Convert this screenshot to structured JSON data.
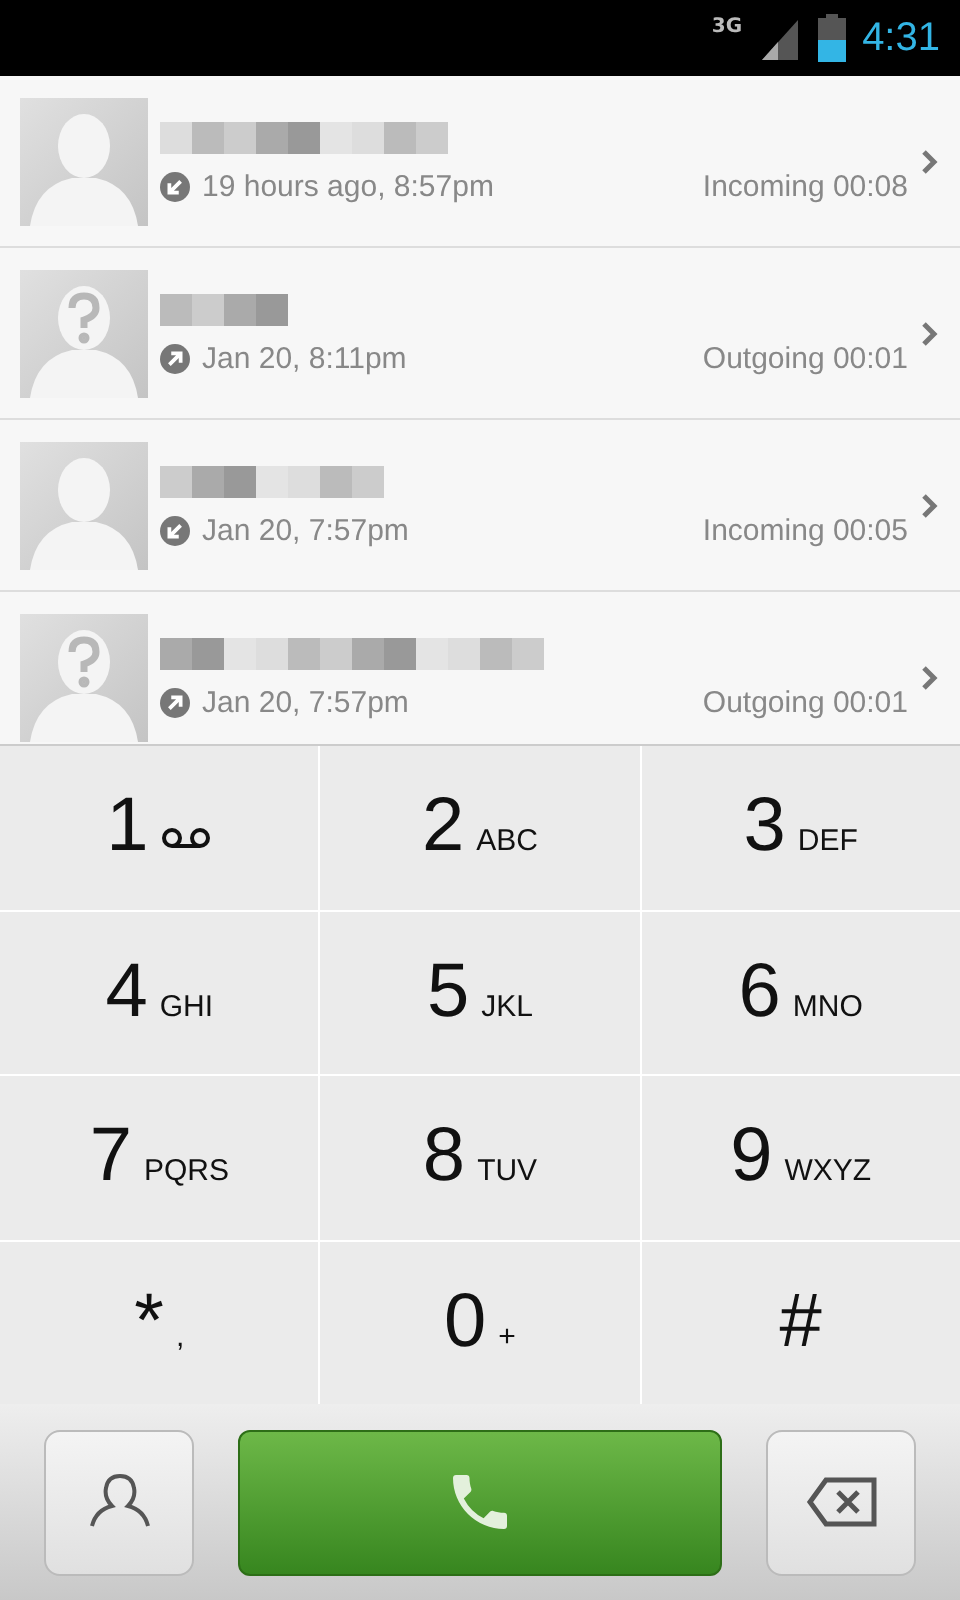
{
  "status_bar": {
    "network": "3G",
    "time": "4:31"
  },
  "calls": [
    {
      "unknown_caller": false,
      "outgoing": false,
      "when": "19 hours ago, 8:57pm",
      "detail": "Incoming 00:08"
    },
    {
      "unknown_caller": true,
      "outgoing": true,
      "when": "Jan 20, 8:11pm",
      "detail": "Outgoing 00:01"
    },
    {
      "unknown_caller": false,
      "outgoing": false,
      "when": "Jan 20, 7:57pm",
      "detail": "Incoming 00:05"
    },
    {
      "unknown_caller": true,
      "outgoing": true,
      "when": "Jan 20, 7:57pm",
      "detail": "Outgoing 00:01"
    }
  ],
  "keypad": [
    {
      "digit": "1",
      "kind": "voicemail"
    },
    {
      "digit": "2",
      "letters": "ABC"
    },
    {
      "digit": "3",
      "letters": "DEF"
    },
    {
      "digit": "4",
      "letters": "GHI"
    },
    {
      "digit": "5",
      "letters": "JKL"
    },
    {
      "digit": "6",
      "letters": "MNO"
    },
    {
      "digit": "7",
      "letters": "PQRS"
    },
    {
      "digit": "8",
      "letters": "TUV"
    },
    {
      "digit": "9",
      "letters": "WXYZ"
    },
    {
      "digit": "*",
      "letters": ","
    },
    {
      "digit": "0",
      "letters": "+"
    },
    {
      "digit": "#"
    }
  ]
}
